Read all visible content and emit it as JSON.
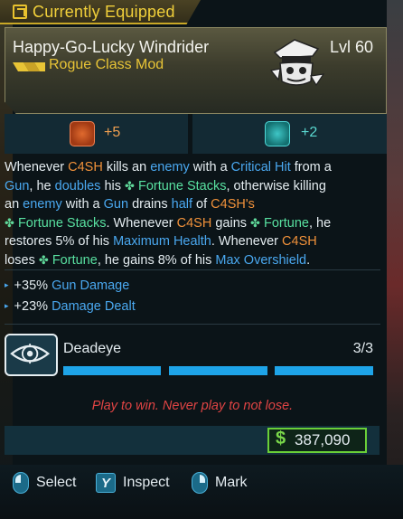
{
  "header": {
    "tab_label": "Currently Equipped",
    "tab_icon": "equipped-check-icon"
  },
  "item": {
    "name": "Happy-Go-Lucky Windrider",
    "level": "Lvl 60",
    "class_mod": "Rogue Class Mod",
    "rarity": "legendary",
    "rarity_color": "#e8c436",
    "character_icon": "c4sh-portrait-icon"
  },
  "stats": [
    {
      "icon": "skull-badge-icon",
      "value": "+5",
      "color": "#f0a050"
    },
    {
      "icon": "teal-splash-icon",
      "value": "+2",
      "color": "#5ad8d0"
    }
  ],
  "description": {
    "line1_a": "Whenever ",
    "c4sh_1": "C4SH",
    "line1_b": " kills an ",
    "enemy_1": "enemy",
    "line1_c": " with a ",
    "crit": "Critical Hit",
    "line1_d": " from a",
    "gun_1": "Gun",
    "line2_a": ", he ",
    "doubles": "doubles",
    "line2_b": " his ",
    "fortune_stacks_1": "Fortune Stacks",
    "line2_c": ", otherwise killing",
    "line3_a": "an ",
    "enemy_2": "enemy",
    "line3_b": " with a ",
    "gun_2": "Gun",
    "line3_c": " drains ",
    "half": "half",
    "line3_d": " of ",
    "c4sh_2": "C4SH's",
    "fortune_stacks_2": "Fortune Stacks",
    "line4_a": ". Whenever ",
    "c4sh_3": "C4SH",
    "line4_b": " gains ",
    "fortune_1": "Fortune",
    "line4_c": ", he",
    "line5_a": "restores 5% of his ",
    "max_health": "Maximum Health",
    "line5_b": ". Whenever ",
    "c4sh_4": "C4SH",
    "line6_a": "loses ",
    "fortune_2": "Fortune",
    "line6_b": ", he gains 8% of his ",
    "max_overshield": "Max Overshield",
    "line6_c": "."
  },
  "bonuses": [
    {
      "value": "+35%",
      "label": "Gun Damage"
    },
    {
      "value": "+23%",
      "label": "Damage Dealt"
    }
  ],
  "perk": {
    "icon": "eye-target-icon",
    "name": "Deadeye",
    "count": "3/3",
    "filled": 3,
    "total": 3,
    "bar_color": "#1ea4e8"
  },
  "flavor_text": "Play to win. Never play to not lose.",
  "price": {
    "symbol": "$",
    "value": "387,090",
    "color": "#7ad84a"
  },
  "prompts": [
    {
      "icon": "mouse-left-icon",
      "label": "Select"
    },
    {
      "key": "Y",
      "label": "Inspect"
    },
    {
      "icon": "mouse-right-icon",
      "label": "Mark"
    }
  ]
}
